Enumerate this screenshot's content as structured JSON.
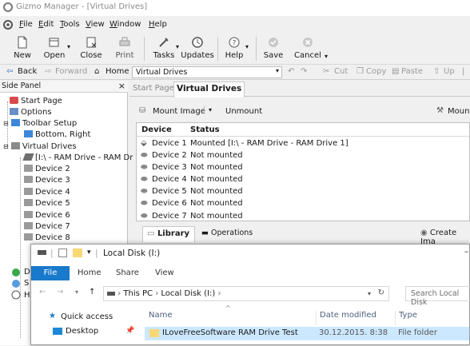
{
  "window": {
    "title": "Gizmo Manager - [Virtual Drives]"
  },
  "menu": [
    "File",
    "Edit",
    "Tools",
    "View",
    "Window",
    "Help"
  ],
  "menu_hotkeys": [
    "F",
    "E",
    "T",
    "V",
    "W",
    "H"
  ],
  "toolbar": {
    "new": "New",
    "open": "Open",
    "close": "Close",
    "print": "Print",
    "tasks": "Tasks",
    "updates": "Updates",
    "help": "Help",
    "save": "Save",
    "cancel": "Cancel"
  },
  "nav": {
    "back": "Back",
    "forward": "Forward",
    "home": "Home",
    "address": "Virtual Drives",
    "cut": "Cut",
    "copy": "Copy",
    "paste": "Paste",
    "up": "Up"
  },
  "side_panel": {
    "title": "Side Panel",
    "items": [
      {
        "label": "Start Page"
      },
      {
        "label": "Options"
      },
      {
        "label": "Toolbar Setup"
      },
      {
        "label": "Bottom, Right"
      },
      {
        "label": "Virtual Drives"
      },
      {
        "label": "[I:\\ - RAM Drive - RAM Dr"
      },
      {
        "label": "Device 2"
      },
      {
        "label": "Device 3"
      },
      {
        "label": "Device 4"
      },
      {
        "label": "Device 5"
      },
      {
        "label": "Device 6"
      },
      {
        "label": "Device 7"
      },
      {
        "label": "Device 8"
      }
    ],
    "partial": [
      "D",
      "S",
      "H"
    ]
  },
  "tabs": {
    "start_page": "Start Page",
    "virtual_drives": "Virtual Drives"
  },
  "vd_toolbar": {
    "mount_image": "Mount Image",
    "unmount": "Unmount",
    "mount_right": "Mount"
  },
  "table": {
    "columns": [
      "Device",
      "Status"
    ],
    "rows": [
      {
        "device": "Device 1",
        "status": "Mounted [I:\\ - RAM Drive - RAM Drive 1]"
      },
      {
        "device": "Device 2",
        "status": "Not mounted"
      },
      {
        "device": "Device 3",
        "status": "Not mounted"
      },
      {
        "device": "Device 4",
        "status": "Not mounted"
      },
      {
        "device": "Device 5",
        "status": "Not mounted"
      },
      {
        "device": "Device 6",
        "status": "Not mounted"
      },
      {
        "device": "Device 7",
        "status": "Not mounted"
      }
    ]
  },
  "bottom_tabs": {
    "library": "Library",
    "operations": "Operations",
    "create": "Create Ima"
  },
  "explorer": {
    "title": "Local Disk (I:)",
    "ribbon": {
      "file": "File",
      "home": "Home",
      "share": "Share",
      "view": "View"
    },
    "breadcrumb": [
      "This PC",
      "Local Disk (I:)"
    ],
    "search_placeholder": "Search Local Disk",
    "quick_access": "Quick access",
    "desktop": "Desktop",
    "columns": {
      "name": "Name",
      "date": "Date modified",
      "type": "Type"
    },
    "rows": [
      {
        "name": "ILoveFreeSoftware RAM Drive Test",
        "date": "30.12.2015. 8:38",
        "type": "File folder"
      }
    ]
  },
  "colors": {
    "accent": "#1979ca",
    "selection": "#cce8ff",
    "folder": "#f8d775"
  }
}
